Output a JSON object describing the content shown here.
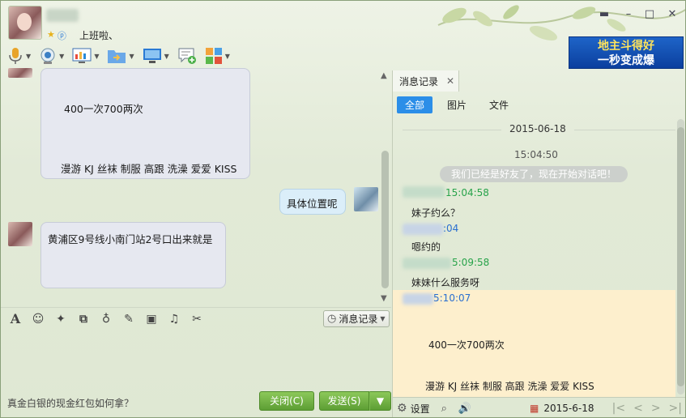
{
  "profile": {
    "signature": "上班啦、"
  },
  "ad": {
    "line1": "地主斗得好",
    "line2": "一秒变成爆"
  },
  "window_controls": [
    "▾",
    "–",
    "□",
    "✕"
  ],
  "toolbar": [
    {
      "name": "microphone-icon"
    },
    {
      "name": "webcam-icon"
    },
    {
      "name": "remote-desktop-icon"
    },
    {
      "name": "send-file-icon"
    },
    {
      "name": "screen-share-icon"
    },
    {
      "name": "new-chat-icon"
    },
    {
      "name": "apps-icon"
    }
  ],
  "chat": {
    "messages": [
      {
        "side": "left",
        "lines": [
          "400一次700两次",
          "漫游 KJ 丝袜 制服 高跟 洗澡 爱爱 KISS"
        ]
      },
      {
        "side": "right",
        "text": "具体位置呢"
      },
      {
        "side": "left",
        "text": "黄浦区9号线小南门站2号口出来就是"
      }
    ]
  },
  "input_toolbar": {
    "history_label": "消息记录"
  },
  "footer": {
    "hint": "真金白银的现金红包如何拿？",
    "close_label": "关闭(C)",
    "send_label": "发送(S)"
  },
  "history": {
    "tab_label": "消息记录",
    "filters": [
      "全部",
      "图片",
      "文件"
    ],
    "date": "2015-06-18",
    "first_time": "15:04:50",
    "system_msg": "我们已经是好友了，现在开始对话吧！",
    "entries": [
      {
        "time": "15:04:58",
        "text": "妹子约么？"
      },
      {
        "time": ":04",
        "text": "嗯约的"
      },
      {
        "time": "5:09:58",
        "text": "妹妹什么服务呀"
      },
      {
        "time": "5:10:07",
        "lines": [
          "400一次700两次",
          "漫游 KJ 丝袜 制服 高跟 洗澡 爱爱 KISS"
        ]
      }
    ],
    "settings_label": "设置",
    "bottom_date": "2015-6-18"
  }
}
